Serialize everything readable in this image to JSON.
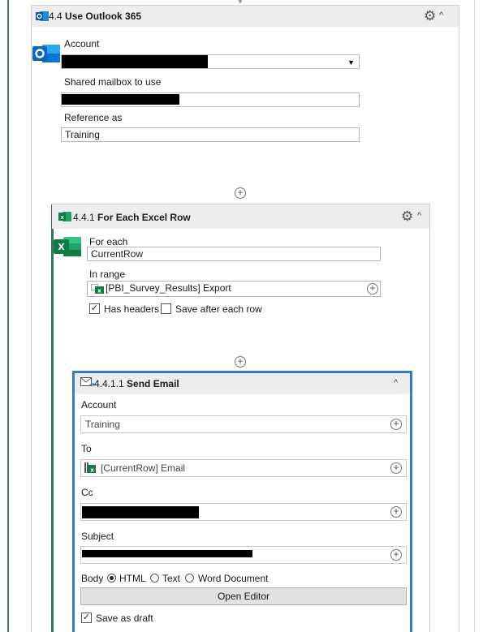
{
  "outlook_scope": {
    "number": "4.4",
    "title": "Use Outlook 365",
    "account_label": "Account",
    "shared_mailbox_label": "Shared mailbox to use",
    "reference_label": "Reference as",
    "reference_value": "Training"
  },
  "excel_scope": {
    "number": "4.4.1",
    "title": "For Each Excel Row",
    "for_each_label": "For each",
    "for_each_value": "CurrentRow",
    "in_range_label": "In range",
    "in_range_value": "[PBI_Survey_Results] Export",
    "has_headers_label": "Has headers",
    "has_headers_checked": true,
    "save_after_label": "Save after each row",
    "save_after_checked": false
  },
  "send_email": {
    "number": "4.4.1.1",
    "title": "Send Email",
    "account_label": "Account",
    "account_value": "Training",
    "to_label": "To",
    "to_value": "[CurrentRow] Email",
    "cc_label": "Cc",
    "subject_label": "Subject",
    "body_label": "Body",
    "body_options": [
      "HTML",
      "Text",
      "Word Document"
    ],
    "body_selected": "HTML",
    "open_editor_label": "Open Editor",
    "save_as_draft_label": "Save as draft",
    "save_as_draft_checked": true
  },
  "colors": {
    "accent_green": "#2e7d60",
    "card_border_blue": "#2f7fc7",
    "header_gray": "#ededed"
  },
  "icons": [
    "outlook-icon",
    "excel-icon",
    "gear-icon",
    "chevron-up-icon",
    "add-circle-icon",
    "envelope-icon",
    "excel-range-icon",
    "excel-column-icon",
    "dropdown-arrow-icon"
  ]
}
